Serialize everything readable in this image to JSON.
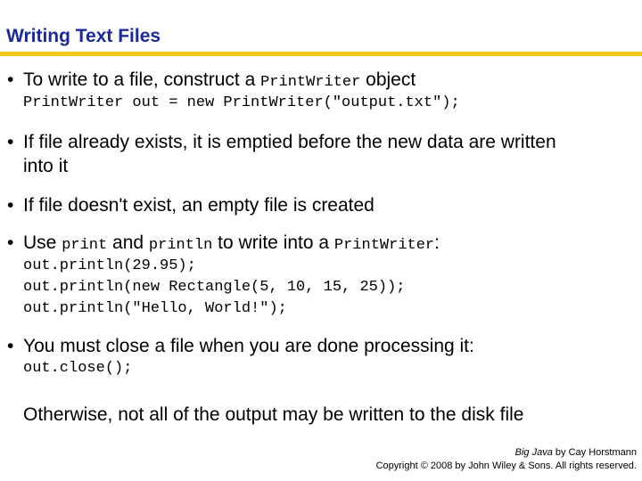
{
  "title": "Writing Text Files",
  "bullets": [
    {
      "parts": [
        "To write to a file, construct a ",
        "PrintWriter",
        " object"
      ],
      "code": [
        "PrintWriter out = new PrintWriter(\"output.txt\");"
      ]
    },
    {
      "line1": "If file already exists, it is emptied before the new data are written",
      "line2": "into it"
    },
    {
      "text": "If file doesn't exist, an empty file is created"
    },
    {
      "parts": [
        "Use ",
        "print",
        " and ",
        "println",
        " to write into a ",
        "PrintWriter",
        ":"
      ],
      "code": [
        "out.println(29.95);",
        "out.println(new Rectangle(5, 10, 15, 25));",
        "out.println(\"Hello, World!\");"
      ]
    },
    {
      "text": "You must close a file when you are done processing it:",
      "code": [
        "out.close();"
      ],
      "followup": "Otherwise, not all of the output may be written to the disk file"
    }
  ],
  "footer": {
    "book": "Big Java",
    "author": " by Cay Horstmann",
    "copyright": "Copyright © 2008 by John Wiley & Sons.  All rights reserved."
  }
}
